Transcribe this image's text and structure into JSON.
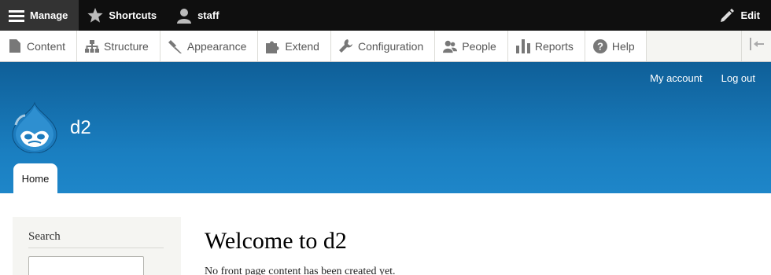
{
  "toolbar": {
    "manage": "Manage",
    "shortcuts": "Shortcuts",
    "user": "staff",
    "edit": "Edit"
  },
  "tray": {
    "items": [
      {
        "label": "Content",
        "icon": "file-icon"
      },
      {
        "label": "Structure",
        "icon": "sitemap-icon"
      },
      {
        "label": "Appearance",
        "icon": "paint-icon"
      },
      {
        "label": "Extend",
        "icon": "puzzle-icon"
      },
      {
        "label": "Configuration",
        "icon": "wrench-icon"
      },
      {
        "label": "People",
        "icon": "people-icon"
      },
      {
        "label": "Reports",
        "icon": "bar-chart-icon"
      },
      {
        "label": "Help",
        "icon": "help-icon"
      }
    ]
  },
  "header": {
    "secondary_nav": [
      "My account",
      "Log out"
    ],
    "site_name": "d2",
    "primary_tab": "Home"
  },
  "sidebar": {
    "search_title": "Search",
    "search_placeholder": ""
  },
  "main": {
    "title": "Welcome to d2",
    "text": "No front page content has been created yet."
  },
  "colors": {
    "toolbar_bg": "#0f0f0f",
    "header_top": "#0f5f98",
    "header_bottom": "#1e86c9",
    "tray_bg": "#f5f5f2"
  }
}
